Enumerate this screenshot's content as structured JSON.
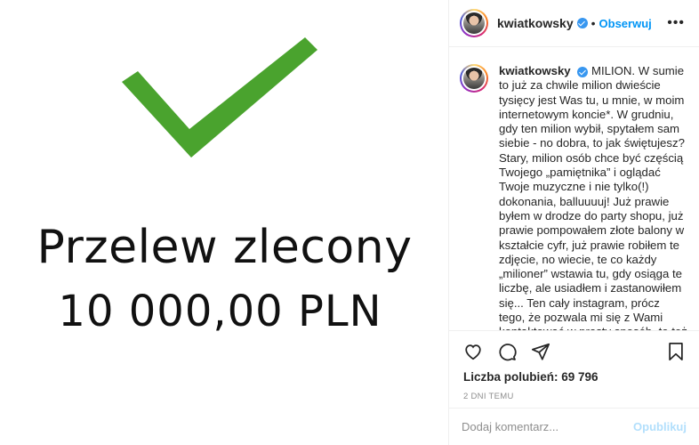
{
  "media": {
    "line1": "Przelew zlecony",
    "line2": "10 000,00 PLN",
    "check_color": "#4aa32e"
  },
  "header": {
    "username": "kwiatkowsky",
    "separator": "•",
    "follow_label": "Obserwuj",
    "more_label": "•••"
  },
  "post": {
    "username": "kwiatkowsky",
    "caption": "MILION. W sumie to już za chwile milion dwieście tysięcy jest Was tu, u mnie, w moim internetowym koncie*. W grudniu, gdy ten milion wybił, spytałem sam siebie - no dobra, to jak świętujesz? Stary, milion osób chce być częścią Twojego „pamiętnika” i oglądać Twoje muzyczne i nie tylko(!) dokonania, balluuuuj! Już prawie byłem w drodze do party shopu, już prawie pompowałem złote balony w kształcie cyfr, już prawie robiłem te zdjęcie, no wiecie, te co każdy „milioner” wstawia tu, gdy osiąga te liczbę, ale usiadłem i zastanowiłem się... Ten cały instagram, prócz tego, że pozwala mi się z Wami kontaktować w prosty sposób, to też narzędzie do pracy i źródło dochodów. Dlaczego więc nie"
  },
  "actions": {
    "icons": [
      "heart-icon",
      "comment-icon",
      "share-icon",
      "bookmark-icon"
    ],
    "likes_text": "Liczba polubień: 69 796",
    "time_text": "2 DNI TEMU"
  },
  "comment": {
    "placeholder": "Dodaj komentarz...",
    "publish_label": "Opublikuj"
  },
  "colors": {
    "accent": "#0095f6",
    "verified": "#3897f0",
    "publish_disabled": "#b2dffc"
  }
}
